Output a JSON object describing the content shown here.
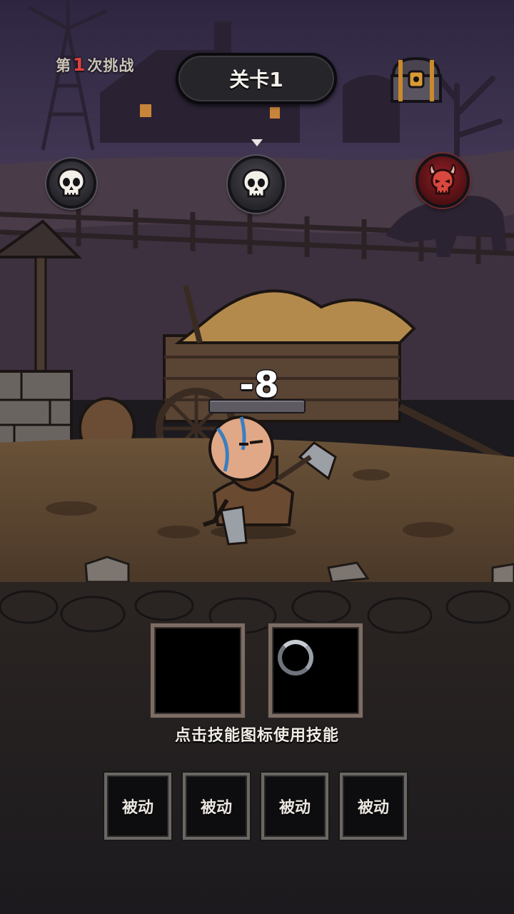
{
  "header": {
    "attempt_prefix": "第",
    "attempt_number": "1",
    "attempt_suffix": "次挑战",
    "stage_title": "关卡1"
  },
  "progress": {
    "nodes": [
      {
        "type": "skull-icon",
        "state": "cleared"
      },
      {
        "type": "skull-icon",
        "state": "current"
      },
      {
        "type": "demon-skull-icon",
        "state": "boss"
      }
    ],
    "current_index": 1
  },
  "battle": {
    "damage_text": "-8",
    "enemy_hp_fraction": 0
  },
  "skills": {
    "active_slots": [
      {
        "state": "empty"
      },
      {
        "state": "cooldown"
      }
    ],
    "hint": "点击技能图标使用技能",
    "passives": [
      {
        "label": "被动"
      },
      {
        "label": "被动"
      },
      {
        "label": "被动"
      },
      {
        "label": "被动"
      }
    ]
  },
  "colors": {
    "accent_red": "#e0413c",
    "sky": "#3d3350",
    "ground": "#5a4532",
    "boss_node": "#8f1f24"
  }
}
